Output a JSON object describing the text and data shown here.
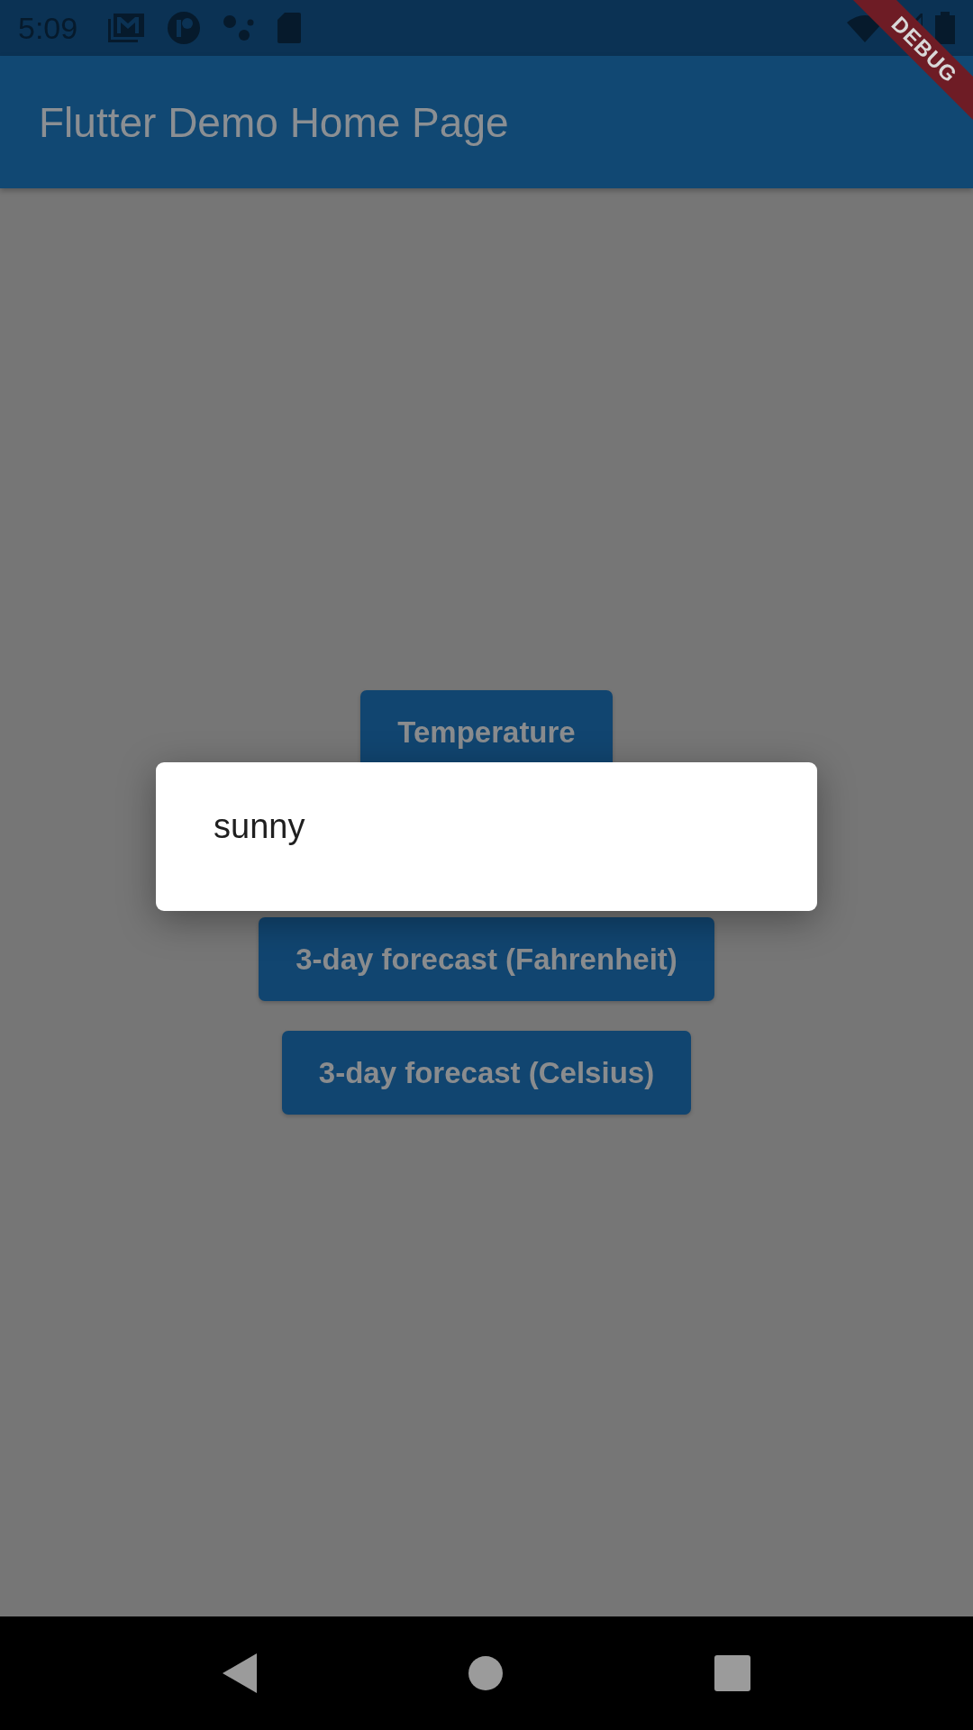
{
  "status_bar": {
    "time": "5:09"
  },
  "debug_banner": {
    "label": "DEBUG"
  },
  "app_bar": {
    "title": "Flutter Demo Home Page"
  },
  "buttons": [
    {
      "label": "Temperature"
    },
    {
      "label": "3-day forecast (Fahrenheit)"
    },
    {
      "label": "3-day forecast (Celsius)"
    }
  ],
  "dialog": {
    "message": "sunny"
  }
}
